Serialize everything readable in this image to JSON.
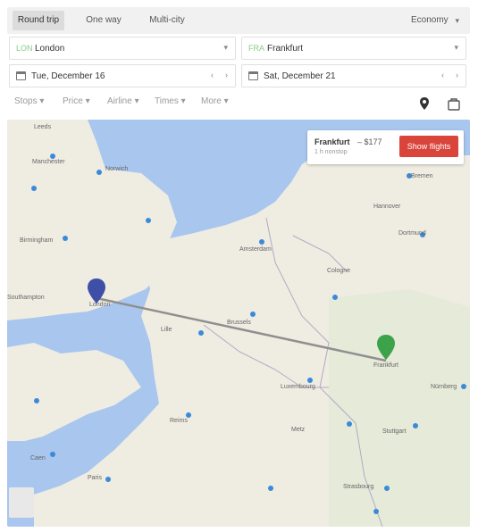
{
  "tabs": [
    {
      "label": "Round trip",
      "active": true
    },
    {
      "label": "One way",
      "active": false
    },
    {
      "label": "Multi-city",
      "active": false
    }
  ],
  "cabin_class": "Economy",
  "origin": {
    "code": "LON",
    "value": "London"
  },
  "destination": {
    "code": "FRA",
    "value": "Frankfurt"
  },
  "depart_date": "Tue, December 16",
  "return_date": "Sat, December 21",
  "filters": [
    "Stops",
    "Price",
    "Airline",
    "Times",
    "More"
  ],
  "icons": {
    "origin_marker_color": "#3f4fa8",
    "destination_marker_color": "#3da34a",
    "map_pin": "map-pin-icon",
    "bag": "bag-icon"
  },
  "map": {
    "info_card": {
      "destination": "Frankfurt",
      "price": "– $177",
      "subtitle": "1 h nonstop",
      "button": "Show flights"
    },
    "places": [
      {
        "name": "London"
      },
      {
        "name": "Frankfurt"
      },
      {
        "name": "Amsterdam"
      },
      {
        "name": "Brussels"
      },
      {
        "name": "Lille"
      },
      {
        "name": "Luxembourg"
      },
      {
        "name": "Cologne"
      },
      {
        "name": "Birmingham"
      },
      {
        "name": "Norwich"
      },
      {
        "name": "Southampton"
      },
      {
        "name": "Paris"
      },
      {
        "name": "Reims"
      },
      {
        "name": "Strasbourg"
      },
      {
        "name": "Stuttgart"
      },
      {
        "name": "Nürnberg"
      },
      {
        "name": "Hannover"
      },
      {
        "name": "Dortmund"
      },
      {
        "name": "Bremen"
      },
      {
        "name": "Leeds"
      },
      {
        "name": "Manchester"
      },
      {
        "name": "Caen"
      },
      {
        "name": "Metz"
      }
    ]
  }
}
